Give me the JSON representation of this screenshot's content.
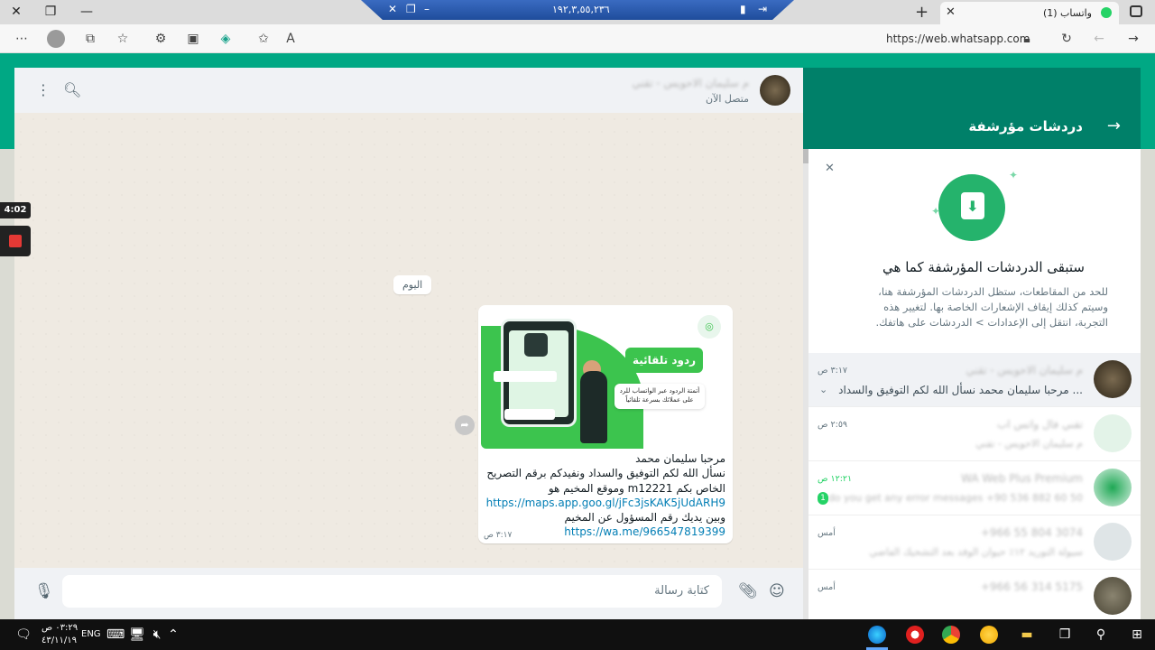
{
  "browser": {
    "tab_title": "(1) واتساب",
    "url": "https://web.whatsapp.com",
    "remote_ip": "١٩٢,٣,٥٥,٢٣٦",
    "new_tab": "+"
  },
  "chat": {
    "contact_status": "متصل الآن",
    "day_badge": "اليوم",
    "message": {
      "promo_button": "ردود تلقائية",
      "promo_tag": "أتمتة الردود عبر الواتساب للرد على عملائك بسرعة تلقائياً",
      "promo_logo": "◎",
      "line1": "مرحبا سليمان محمد",
      "line2": "نسأل الله لكم التوفيق والسداد ونفيدكم برقم التصريح الخاص بكم m12221 وموقع المخيم هو",
      "link1": "https://maps.app.goo.gl/jFc3jsKAK5jUdARH9",
      "line3": "وبين يديك رقم المسؤول عن المخيم",
      "link2": "https://wa.me/966547819399",
      "time": "٣:١٧ ص"
    },
    "composer_placeholder": "كتابة رسالة"
  },
  "archived": {
    "title": "دردشات مؤرشفة",
    "notice_heading": "ستبقى الدردشات المؤرشفة كما هي",
    "notice_body": "للحد من المقاطعات، ستظل الدردشات المؤرشفة هنا، وسيتم كذلك إيقاف الإشعارات الخاصة بها. لتغيير هذه التجربة، انتقل إلى الإعدادات > الدردشات على هاتفك.",
    "rows": [
      {
        "name": "م سليمان الاحويس - تقني",
        "preview": "مرحبا سليمان محمد  نسأل الله لكم التوفيق والسداد ...",
        "time": "٣:١٧ ص"
      },
      {
        "name": "تقني فال واتس اب",
        "preview": "م سليمان الاحويس - تقني",
        "time": "٢:٥٩ ص"
      },
      {
        "name": "WA Web Plus Premium",
        "preview": "do you get any error messages +90 536 882 60 50",
        "time": "١٢:٢١ ص",
        "unread": "1"
      },
      {
        "name": "+966 55 804 3074",
        "preview": "سيولة التوريد ١٢٪ حيوان الوفد بعد التشحيك الفاضي",
        "time": "أمس"
      },
      {
        "name": "+966 56 314 5175",
        "preview": "",
        "time": "أمس"
      }
    ]
  },
  "recorder": {
    "time": "4:02"
  },
  "taskbar": {
    "time": "٠٣:٢٩ ص",
    "date": "٤٣/١١/١٩",
    "lang": "ENG"
  },
  "colors": {
    "accent": "#00a884",
    "header": "#008069",
    "link": "#027eb5",
    "unread": "#25d366"
  }
}
